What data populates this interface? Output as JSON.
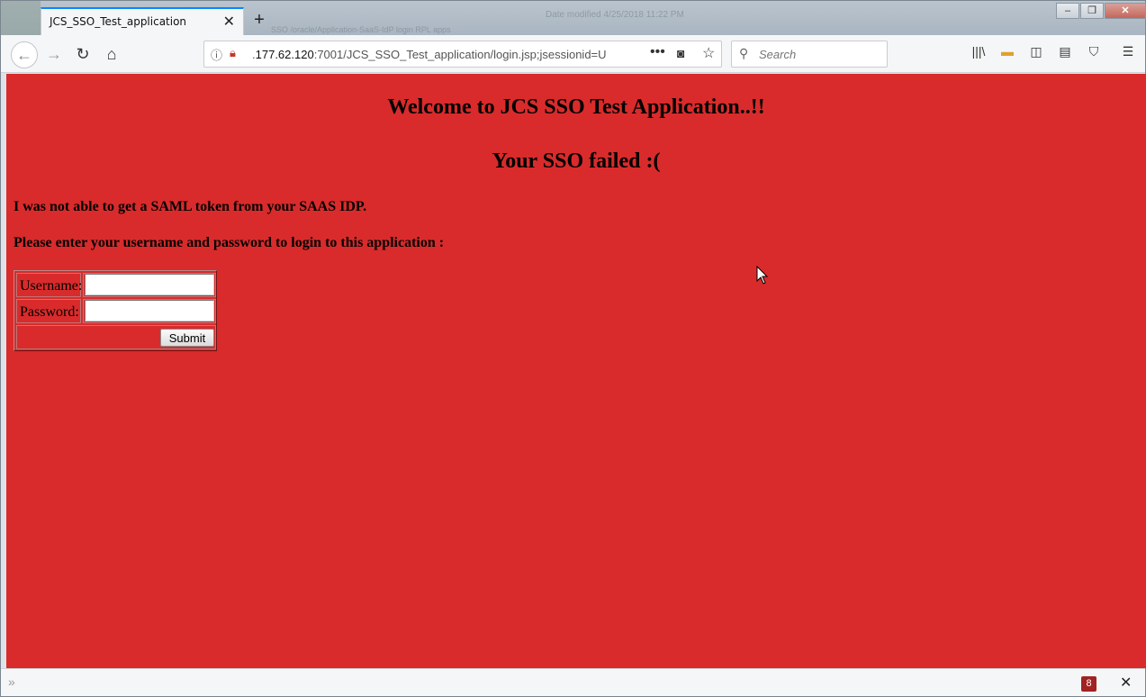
{
  "browser": {
    "tab_title": "JCS_SSO_Test_application",
    "background_window_text_1": "Date modified 4/25/2018 11:22 PM",
    "background_window_text_2": "SSO /oracle/Application-SaaS-IdP login   RPL apps",
    "url_prefix": ".",
    "url_host": "177.62.120",
    "url_rest": ":7001/JCS_SSO_Test_application/login.jsp;jsessionid=U",
    "search_placeholder": "Search",
    "notification_count": "8"
  },
  "page": {
    "heading": "Welcome to JCS SSO Test Application..!!",
    "subheading": "Your SSO failed :(",
    "message": "I was not able to get a SAML token from your SAAS IDP.",
    "prompt": "Please enter your username and password to login to this application :",
    "username_label": "Username:",
    "password_label": "Password:",
    "username_value": "",
    "password_value": "",
    "submit_label": "Submit"
  },
  "colors": {
    "page_background": "#d92b2b",
    "tab_accent": "#0a84ff"
  }
}
